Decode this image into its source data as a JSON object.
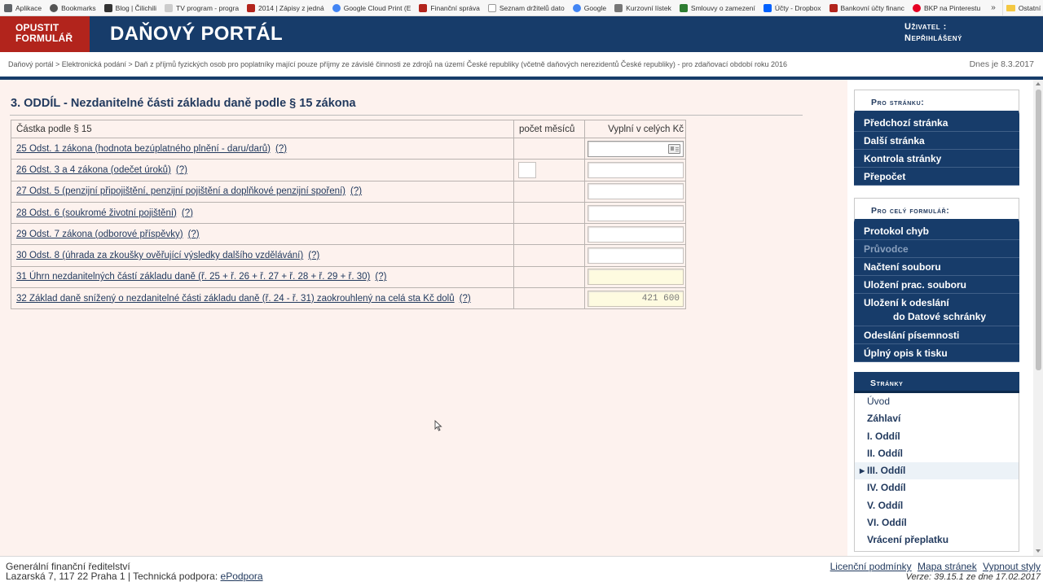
{
  "bookmarks": {
    "items": [
      {
        "label": "Aplikace",
        "color": "#5f6368"
      },
      {
        "label": "Bookmarks",
        "color": "#555555"
      },
      {
        "label": "Blog | Čilichili",
        "color": "#333333"
      },
      {
        "label": "TV program - progra",
        "color": "#cccccc"
      },
      {
        "label": "2014 | Zápisy z jedná",
        "color": "#b2241c"
      },
      {
        "label": "Google Cloud Print (E",
        "color": "#4285f4"
      },
      {
        "label": "Finanční správa",
        "color": "#b2241c"
      },
      {
        "label": "Seznam držitelů dato",
        "color": "#999999"
      },
      {
        "label": "Google",
        "color": "#4285f4"
      },
      {
        "label": "Kurzovní lístek",
        "color": "#777777"
      },
      {
        "label": "Smlouvy o zamezení",
        "color": "#2e7d32"
      },
      {
        "label": "Účty - Dropbox",
        "color": "#0061fe"
      },
      {
        "label": "Bankovní účty financ",
        "color": "#b2241c"
      },
      {
        "label": "BKP na Pinterestu",
        "color": "#e60023"
      }
    ],
    "more": "»",
    "other": "Ostatní záložky"
  },
  "header": {
    "exit_line1": "OPUSTIT",
    "exit_line2": "FORMULÁŘ",
    "title": "DAŇOVÝ PORTÁL",
    "user_label": "Uživatel :",
    "user_value": "Nepřihlášený"
  },
  "breadcrumb": {
    "path": "Daňový portál > Elektronická podání > Daň z příjmů fyzických osob pro poplatníky mající pouze příjmy ze závislé činnosti ze zdrojů na území České republiky (včetně daňových nerezidentů České republiky) - pro zdaňovací období roku 2016",
    "date": "Dnes je 8.3.2017"
  },
  "main": {
    "section_title": "3. ODDÍL - Nezdanitelné části základu daně podle § 15 zákona",
    "table": {
      "col1": "Částka podle § 15",
      "col2": "počet měsíců",
      "col3": "Vyplní v celých Kč",
      "rows": [
        {
          "label": "25 Odst. 1 zákona (hodnota bezúplatného plnění - daru/darů)",
          "help": "(?)",
          "value": ""
        },
        {
          "label": "26 Odst. 3 a 4 zákona (odečet úroků)",
          "help": "(?)",
          "value": ""
        },
        {
          "label": "27 Odst. 5 (penzijní připojištění, penzijní pojištění a doplňkové penzijní spoření)",
          "help": "(?)",
          "value": ""
        },
        {
          "label": "28 Odst. 6 (soukromé životní pojištění)",
          "help": "(?)",
          "value": ""
        },
        {
          "label": "29 Odst. 7 zákona (odborové příspěvky)",
          "help": "(?)",
          "value": ""
        },
        {
          "label": "30 Odst. 8 (úhrada za zkoušky ověřující výsledky dalšího vzdělávání)",
          "help": "(?)",
          "value": ""
        },
        {
          "label": "31 Úhrn nezdanitelných částí základu daně (ř. 25 + ř. 26 + ř. 27 + ř. 28 + ř. 29 + ř. 30)",
          "help": "(?)",
          "value": ""
        },
        {
          "label": "32 Základ daně snížený o nezdanitelné části základu daně (ř. 24 - ř. 31) zaokrouhlený na celá sta Kč dolů",
          "help": "(?)",
          "value": "421 600"
        }
      ]
    }
  },
  "sidebar": {
    "page_panel": {
      "title": "Pro stránku:",
      "items": [
        "Předchozí stránka",
        "Další stránka",
        "Kontrola stránky",
        "Přepočet"
      ]
    },
    "form_panel": {
      "title": "Pro celý formulář:",
      "items": [
        "Protokol chyb",
        "Průvodce",
        "Načtení souboru",
        "Uložení prac. souboru"
      ],
      "submit_line1": "Uložení k odeslání",
      "submit_line2": "do Datové schránky",
      "items2": [
        "Odeslání písemnosti",
        "Úplný opis k tisku"
      ]
    },
    "pages_panel": {
      "title": "Stránky",
      "items": [
        "Úvod",
        "Záhlaví",
        "I. Oddíl",
        "II. Oddíl",
        "III. Oddíl",
        "IV. Oddíl",
        "V. Oddíl",
        "VI. Oddíl",
        "Vrácení přeplatku"
      ],
      "active_index": 4
    }
  },
  "footer": {
    "org": "Generální finanční ředitelství",
    "address": "Lazarská 7, 117 22 Praha 1 | Technická podpora:",
    "support_link": "ePodpora",
    "links": [
      "Licenční podmínky",
      "Mapa stránek",
      "Vypnout styly"
    ],
    "version": "Verze: 39.15.1 ze dne 17.02.2017"
  },
  "colors": {
    "header_bg": "#173c6a",
    "exit_button_bg": "#b2241c",
    "main_bg": "#fdf2ee",
    "computed_field_bg": "#fefbe0"
  }
}
